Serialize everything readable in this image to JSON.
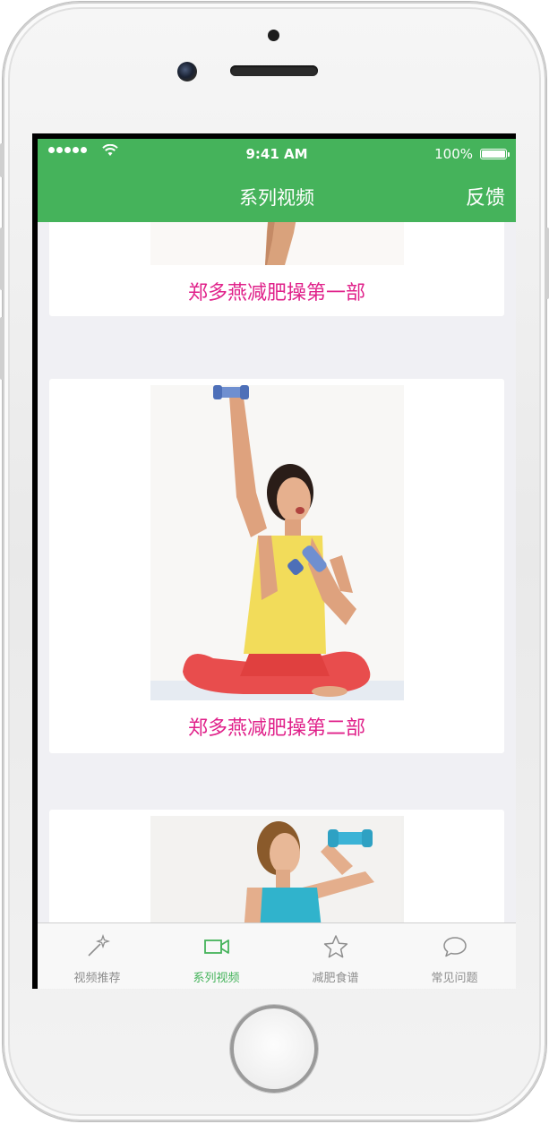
{
  "status_bar": {
    "time": "9:41 AM",
    "battery": "100%"
  },
  "nav": {
    "title": "系列视频",
    "feedback": "反馈"
  },
  "videos": [
    {
      "title": "郑多燕减肥操第一部"
    },
    {
      "title": "郑多燕减肥操第二部"
    },
    {
      "title": ""
    }
  ],
  "tabs": [
    {
      "label": "视频推荐",
      "icon": "magic-wand-icon",
      "active": false
    },
    {
      "label": "系列视频",
      "icon": "video-camera-icon",
      "active": true
    },
    {
      "label": "减肥食谱",
      "icon": "star-icon",
      "active": false
    },
    {
      "label": "常见问题",
      "icon": "chat-bubble-icon",
      "active": false
    }
  ],
  "colors": {
    "accent": "#45b35b",
    "title_text": "#e0218a",
    "background": "#f0f0f4"
  }
}
